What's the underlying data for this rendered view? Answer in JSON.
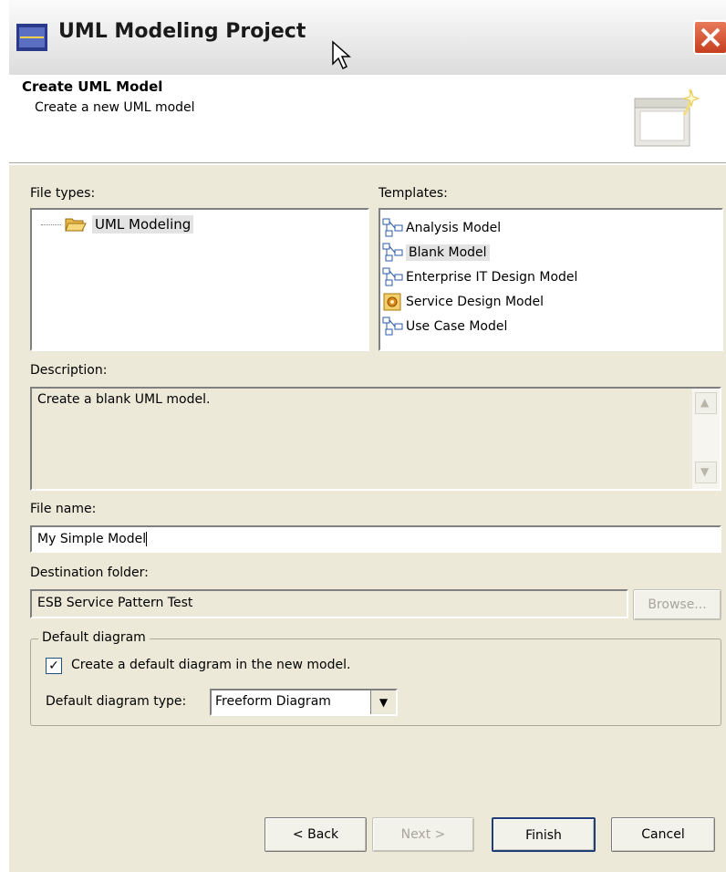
{
  "window": {
    "title": "UML Modeling Project"
  },
  "header": {
    "title": "Create UML Model",
    "subtitle": "Create a new UML model"
  },
  "file_types": {
    "label": "File types:",
    "items": [
      "UML Modeling"
    ]
  },
  "templates": {
    "label": "Templates:",
    "items": [
      {
        "label": "Analysis Model",
        "icon": "uml-model-icon",
        "selected": false
      },
      {
        "label": "Blank Model",
        "icon": "uml-model-icon",
        "selected": true
      },
      {
        "label": "Enterprise IT Design Model",
        "icon": "uml-model-icon",
        "selected": false
      },
      {
        "label": "Service Design Model",
        "icon": "service-model-icon",
        "selected": false
      },
      {
        "label": "Use Case Model",
        "icon": "uml-model-icon",
        "selected": false
      }
    ]
  },
  "description": {
    "label": "Description:",
    "text": "Create a blank UML model."
  },
  "file_name": {
    "label": "File name:",
    "value": "My Simple Model"
  },
  "destination": {
    "label": "Destination folder:",
    "value": "ESB Service Pattern Test",
    "browse_label": "Browse..."
  },
  "default_diagram": {
    "legend": "Default diagram",
    "checkbox_label": "Create a default diagram in the new model.",
    "checked": true,
    "type_label": "Default diagram type:",
    "type_value": "Freeform Diagram"
  },
  "buttons": {
    "back": "< Back",
    "next": "Next >",
    "finish": "Finish",
    "cancel": "Cancel"
  }
}
